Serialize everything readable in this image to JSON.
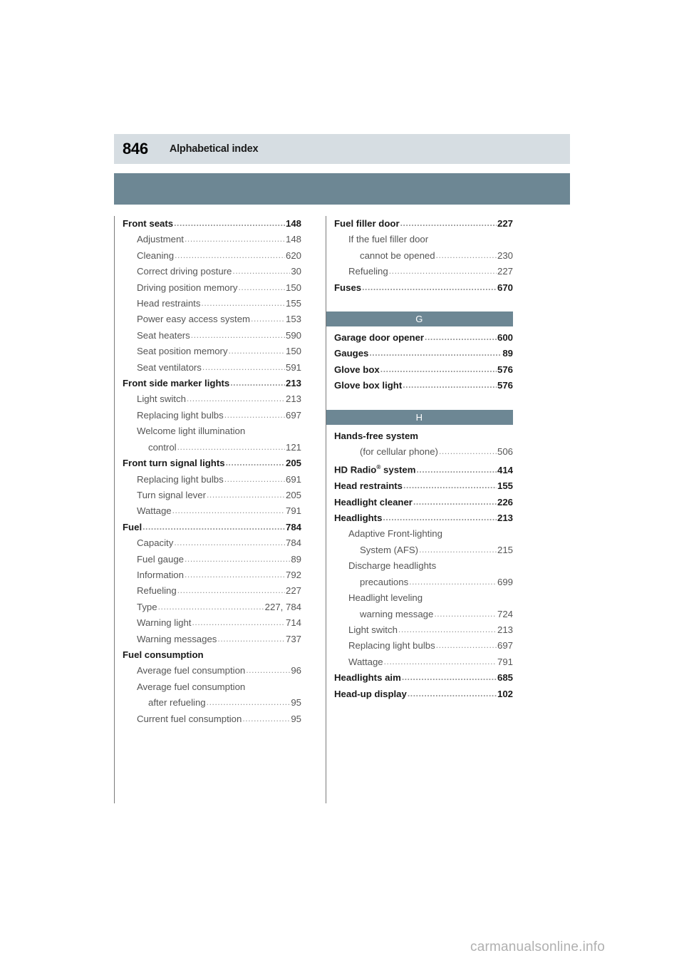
{
  "header": {
    "page_number": "846",
    "title": "Alphabetical index"
  },
  "footer": {
    "watermark": "carmanualsonline.info"
  },
  "colors": {
    "title_band": "#d6dde2",
    "accent_band": "#6d8794",
    "letter_band": "#6d8794",
    "rule": "#7a7a7a"
  },
  "left_column": [
    {
      "level": 0,
      "label": "Front seats",
      "page": "148",
      "leader": true
    },
    {
      "level": 1,
      "label": "Adjustment",
      "page": "148",
      "leader": true
    },
    {
      "level": 1,
      "label": "Cleaning",
      "page": "620",
      "leader": true
    },
    {
      "level": 1,
      "label": "Correct driving posture",
      "page": "30",
      "leader": true
    },
    {
      "level": 1,
      "label": "Driving position memory",
      "page": "150",
      "leader": true
    },
    {
      "level": 1,
      "label": "Head restraints",
      "page": "155",
      "leader": true
    },
    {
      "level": 1,
      "label": "Power easy access system",
      "page": "153",
      "leader": true
    },
    {
      "level": 1,
      "label": "Seat heaters",
      "page": "590",
      "leader": true
    },
    {
      "level": 1,
      "label": "Seat position memory",
      "page": "150",
      "leader": true
    },
    {
      "level": 1,
      "label": "Seat ventilators",
      "page": "591",
      "leader": true
    },
    {
      "level": 0,
      "label": "Front side marker lights",
      "page": "213",
      "leader": true
    },
    {
      "level": 1,
      "label": "Light switch",
      "page": "213",
      "leader": true
    },
    {
      "level": 1,
      "label": "Replacing light bulbs",
      "page": "697",
      "leader": true
    },
    {
      "level": 1,
      "label": "Welcome light illumination",
      "page": "",
      "leader": false
    },
    {
      "level": 2,
      "label": "control",
      "page": "121",
      "leader": true
    },
    {
      "level": 0,
      "label": "Front turn signal lights",
      "page": "205",
      "leader": true
    },
    {
      "level": 1,
      "label": "Replacing light bulbs",
      "page": "691",
      "leader": true
    },
    {
      "level": 1,
      "label": "Turn signal lever",
      "page": "205",
      "leader": true
    },
    {
      "level": 1,
      "label": "Wattage",
      "page": "791",
      "leader": true
    },
    {
      "level": 0,
      "label": "Fuel",
      "page": "784",
      "leader": true
    },
    {
      "level": 1,
      "label": "Capacity",
      "page": "784",
      "leader": true
    },
    {
      "level": 1,
      "label": "Fuel gauge",
      "page": "89",
      "leader": true
    },
    {
      "level": 1,
      "label": "Information",
      "page": "792",
      "leader": true
    },
    {
      "level": 1,
      "label": "Refueling",
      "page": "227",
      "leader": true
    },
    {
      "level": 1,
      "label": "Type",
      "page": "227, 784",
      "leader": true
    },
    {
      "level": 1,
      "label": "Warning light",
      "page": "714",
      "leader": true
    },
    {
      "level": 1,
      "label": "Warning messages",
      "page": "737",
      "leader": true
    },
    {
      "level": 0,
      "label": "Fuel consumption",
      "page": "",
      "leader": false
    },
    {
      "level": 1,
      "label": "Average fuel consumption",
      "page": "96",
      "leader": true
    },
    {
      "level": 1,
      "label": "Average fuel consumption",
      "page": "",
      "leader": false
    },
    {
      "level": 2,
      "label": "after refueling",
      "page": "95",
      "leader": true
    },
    {
      "level": 1,
      "label": "Current fuel consumption",
      "page": "95",
      "leader": true
    }
  ],
  "right_column": [
    {
      "type": "entry",
      "level": 0,
      "label": "Fuel filler door",
      "page": "227",
      "leader": true
    },
    {
      "type": "entry",
      "level": 1,
      "label": "If the fuel filler door",
      "page": "",
      "leader": false
    },
    {
      "type": "entry",
      "level": 2,
      "label": "cannot be opened",
      "page": "230",
      "leader": true
    },
    {
      "type": "entry",
      "level": 1,
      "label": "Refueling",
      "page": "227",
      "leader": true
    },
    {
      "type": "entry",
      "level": 0,
      "label": "Fuses",
      "page": "670",
      "leader": true
    },
    {
      "type": "band",
      "letter": "G"
    },
    {
      "type": "entry",
      "level": 0,
      "label": "Garage door opener",
      "page": "600",
      "leader": true
    },
    {
      "type": "entry",
      "level": 0,
      "label": "Gauges",
      "page": "89",
      "leader": true
    },
    {
      "type": "entry",
      "level": 0,
      "label": "Glove box",
      "page": "576",
      "leader": true
    },
    {
      "type": "entry",
      "level": 0,
      "label": "Glove box light",
      "page": "576",
      "leader": true
    },
    {
      "type": "band",
      "letter": "H"
    },
    {
      "type": "entry",
      "level": 0,
      "label": "Hands-free system",
      "page": "",
      "leader": false
    },
    {
      "type": "entry",
      "level": 2,
      "label": "(for cellular phone)",
      "page": "506",
      "leader": true
    },
    {
      "type": "entry",
      "level": 0,
      "label": "HD Radio® system",
      "page": "414",
      "leader": true,
      "superscript": "®",
      "base_label": "HD Radio",
      "tail_label": " system"
    },
    {
      "type": "entry",
      "level": 0,
      "label": "Head restraints",
      "page": "155",
      "leader": true
    },
    {
      "type": "entry",
      "level": 0,
      "label": "Headlight cleaner",
      "page": "226",
      "leader": true
    },
    {
      "type": "entry",
      "level": 0,
      "label": "Headlights",
      "page": "213",
      "leader": true
    },
    {
      "type": "entry",
      "level": 1,
      "label": "Adaptive Front-lighting",
      "page": "",
      "leader": false
    },
    {
      "type": "entry",
      "level": 2,
      "label": "System (AFS)",
      "page": "215",
      "leader": true
    },
    {
      "type": "entry",
      "level": 1,
      "label": "Discharge headlights",
      "page": "",
      "leader": false
    },
    {
      "type": "entry",
      "level": 2,
      "label": "precautions",
      "page": "699",
      "leader": true
    },
    {
      "type": "entry",
      "level": 1,
      "label": "Headlight leveling",
      "page": "",
      "leader": false
    },
    {
      "type": "entry",
      "level": 2,
      "label": "warning message",
      "page": "724",
      "leader": true
    },
    {
      "type": "entry",
      "level": 1,
      "label": "Light switch",
      "page": "213",
      "leader": true
    },
    {
      "type": "entry",
      "level": 1,
      "label": "Replacing light bulbs",
      "page": "697",
      "leader": true
    },
    {
      "type": "entry",
      "level": 1,
      "label": "Wattage",
      "page": "791",
      "leader": true
    },
    {
      "type": "entry",
      "level": 0,
      "label": "Headlights aim",
      "page": "685",
      "leader": true
    },
    {
      "type": "entry",
      "level": 0,
      "label": "Head-up display",
      "page": "102",
      "leader": true
    }
  ]
}
